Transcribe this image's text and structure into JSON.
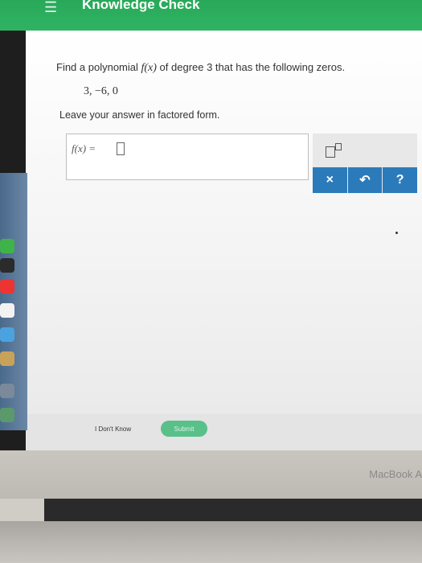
{
  "header": {
    "title": "Knowledge Check",
    "menu_icon": "menu-icon"
  },
  "question": {
    "prefix": "Find a polynomial ",
    "function": "f(x)",
    "suffix": " of degree 3 that has the following zeros.",
    "zeros": "3, −6, 0",
    "instruction": "Leave your answer in factored form."
  },
  "answer": {
    "label": "f(x) ="
  },
  "toolbar": {
    "clear_label": "×",
    "undo_label": "↶",
    "help_label": "?"
  },
  "actions": {
    "dont_know_label": "I Don't Know",
    "submit_label": "Submit"
  },
  "device": {
    "brand": "MacBook A"
  },
  "colors": {
    "header": "#2fb463",
    "tool_buttons": "#2b7bbb",
    "submit": "#59c08a"
  }
}
